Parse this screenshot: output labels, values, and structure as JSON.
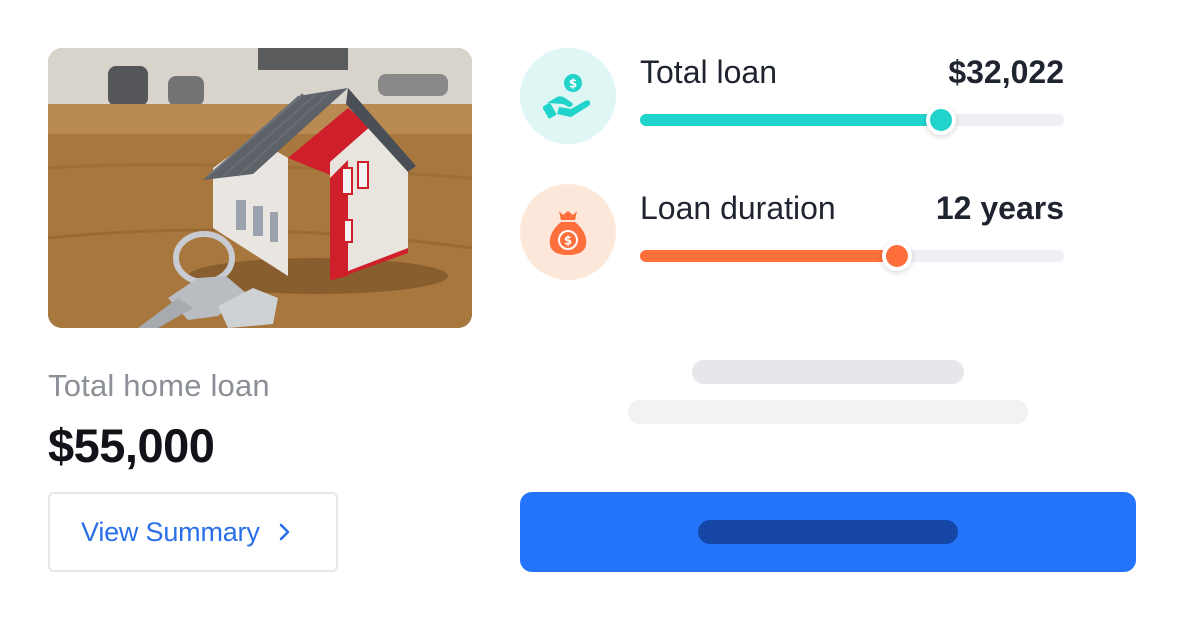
{
  "photo": {
    "alt": "Miniature house with keys on a wooden table"
  },
  "summary": {
    "label": "Total home loan",
    "amount": "$55,000",
    "button_label": "View Summary"
  },
  "sliders": [
    {
      "title": "Total loan",
      "value": "$32,022",
      "level": 0.71,
      "color": "#20d3cb",
      "icon": "hand-coin-icon"
    },
    {
      "title": "Loan duration",
      "value": "12 years",
      "level": 0.605,
      "color": "#ff6f3c",
      "icon": "money-bag-icon"
    }
  ],
  "colors": {
    "accent": "#2473fb",
    "link": "#2a6fe8",
    "teal": "#20d3cb",
    "orange": "#ff6f3c"
  }
}
